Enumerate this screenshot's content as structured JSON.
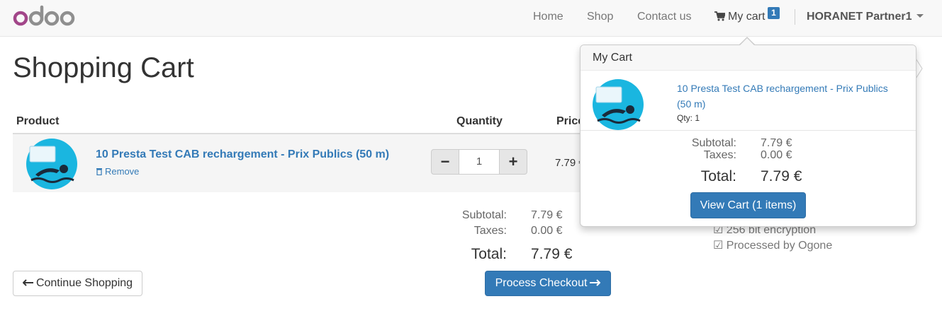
{
  "navbar": {
    "logo_text": "odoo",
    "links": [
      "Home",
      "Shop",
      "Contact us"
    ],
    "cart_label": "My cart",
    "cart_count": "1",
    "user": "HORANET Partner1"
  },
  "page": {
    "title": "Shopping Cart",
    "columns": {
      "product": "Product",
      "quantity": "Quantity",
      "price": "Price"
    },
    "line": {
      "name": "10 Presta Test CAB rechargement - Prix Publics (50 m)",
      "remove": "Remove",
      "qty_minus": "−",
      "qty_plus": "+",
      "quantity": "1",
      "price": "7.79 €"
    },
    "summary": {
      "subtotal_label": "Subtotal:",
      "subtotal": "7.79 €",
      "taxes_label": "Taxes:",
      "taxes": "0.00 €",
      "total_label": "Total:",
      "total": "7.79 €"
    },
    "continue_label": "Continue Shopping",
    "checkout_label": "Process Checkout",
    "security": [
      "☑ 256 bit encryption",
      "☑ Processed by Ogone"
    ]
  },
  "popover": {
    "title": "My Cart",
    "item_name": "10 Presta Test CAB rechargement - Prix Publics (50 m)",
    "qty_text": "Qty: 1",
    "subtotal_label": "Subtotal:",
    "subtotal": "7.79 €",
    "taxes_label": "Taxes:",
    "taxes": "0.00 €",
    "total_label": "Total:",
    "total": "7.79 €",
    "button": "View Cart (1 items)"
  },
  "colors": {
    "primary": "#337ab7",
    "logo_purple": "#a24689",
    "logo_gray": "#8f8f8f",
    "thumb_cyan": "#1ab6e0"
  },
  "icons": [
    "shopping-cart-icon",
    "trash-icon",
    "arrow-left-icon",
    "arrow-right-icon",
    "caret-down-icon",
    "swimmer-icon"
  ]
}
